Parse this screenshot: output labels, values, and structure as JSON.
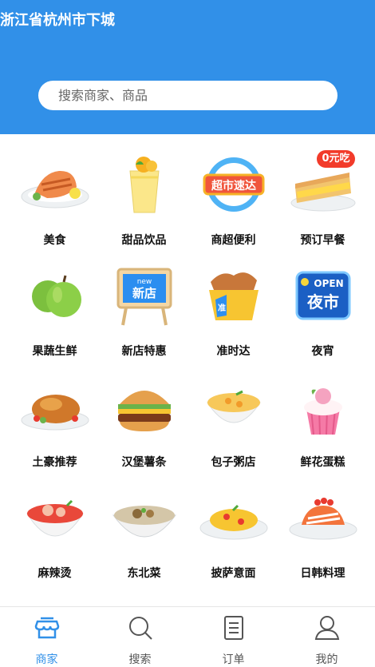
{
  "header": {
    "location": "浙江省杭州市下城",
    "search_placeholder": "搜索商家、商品"
  },
  "categories": [
    {
      "label": "美食",
      "icon": "grilled-salmon-icon"
    },
    {
      "label": "甜品饮品",
      "icon": "mango-drink-icon"
    },
    {
      "label": "商超便利",
      "icon": "supermarket-express-icon",
      "icon_text": "超市速达"
    },
    {
      "label": "预订早餐",
      "icon": "sandwich-icon",
      "badge": "0元吃"
    },
    {
      "label": "果蔬生鲜",
      "icon": "green-apple-icon"
    },
    {
      "label": "新店特惠",
      "icon": "new-store-sign-icon",
      "icon_text": "新店",
      "icon_subtext": "new"
    },
    {
      "label": "准时达",
      "icon": "on-time-box-icon",
      "icon_text": "准"
    },
    {
      "label": "夜宵",
      "icon": "open-night-market-icon",
      "icon_text": "夜市",
      "icon_subtext": "OPEN"
    },
    {
      "label": "土豪推荐",
      "icon": "roast-chicken-icon"
    },
    {
      "label": "汉堡薯条",
      "icon": "burger-icon"
    },
    {
      "label": "包子粥店",
      "icon": "porridge-bowl-icon"
    },
    {
      "label": "鲜花蛋糕",
      "icon": "cupcake-icon"
    },
    {
      "label": "麻辣烫",
      "icon": "malatang-bowl-icon"
    },
    {
      "label": "东北菜",
      "icon": "stew-bowl-icon"
    },
    {
      "label": "披萨意面",
      "icon": "pasta-plate-icon"
    },
    {
      "label": "日韩料理",
      "icon": "sushi-plate-icon"
    }
  ],
  "tabs": [
    {
      "label": "商家",
      "icon": "store-icon",
      "active": true
    },
    {
      "label": "搜索",
      "icon": "search-icon",
      "active": false
    },
    {
      "label": "订单",
      "icon": "order-list-icon",
      "active": false
    },
    {
      "label": "我的",
      "icon": "user-icon",
      "active": false
    }
  ],
  "colors": {
    "brand": "#3190e8",
    "badge": "#f23b2a"
  }
}
